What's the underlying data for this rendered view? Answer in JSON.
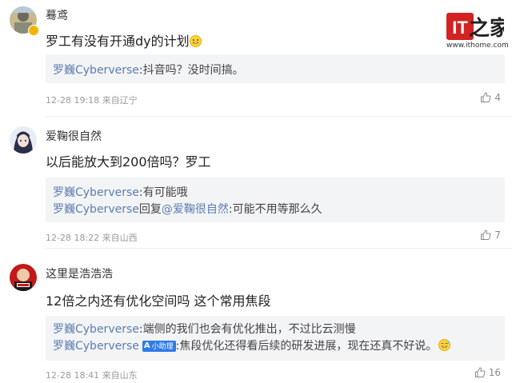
{
  "logo": {
    "text": "IT之家",
    "url": "www.ithome.com"
  },
  "comments": [
    {
      "username": "蓦鸢",
      "text": "罗工有没有开通dy的计划",
      "replies": [
        {
          "author": "罗巍Cyberverse",
          "sep": ":",
          "text": "抖音吗？没时间搞。"
        }
      ],
      "meta": "12-28 19:18 来自辽宁",
      "likes": "4"
    },
    {
      "username": "爱鞠很自然",
      "text": "以后能放大到200倍吗？罗工",
      "replies": [
        {
          "author": "罗巍Cyberverse",
          "sep": ":",
          "text": "有可能哦"
        },
        {
          "author": "罗巍Cyberverse",
          "reply_word": "回复",
          "mention": "@爱鞠很自然",
          "sep": ":",
          "text": "可能不用等那么久"
        }
      ],
      "meta": "12-28 18:22 来自山西",
      "likes": "7"
    },
    {
      "username": "这里是浩浩浩",
      "text": "12倍之内还有优化空间吗 这个常用焦段",
      "replies": [
        {
          "author": "罗巍Cyberverse",
          "sep": ":",
          "text": "端侧的我们也会有优化推出，不过比云测慢"
        },
        {
          "author": "罗巍Cyberverse",
          "badge": "小助理",
          "sep": ":",
          "text": "焦段优化还得看后续的研发进展，现在还真不好说。"
        }
      ],
      "meta": "12-28 18:41 来自山东",
      "likes": "16"
    }
  ],
  "colors": {
    "link": "#5b7db1",
    "reply_bg": "#f3f4f6",
    "meta": "#9a9a9a",
    "logo_red": "#d22222",
    "badge": "#2f7be8"
  },
  "icons": [
    "thumbs-up-icon",
    "grin-emoji-icon",
    "vip-badge-icon"
  ]
}
